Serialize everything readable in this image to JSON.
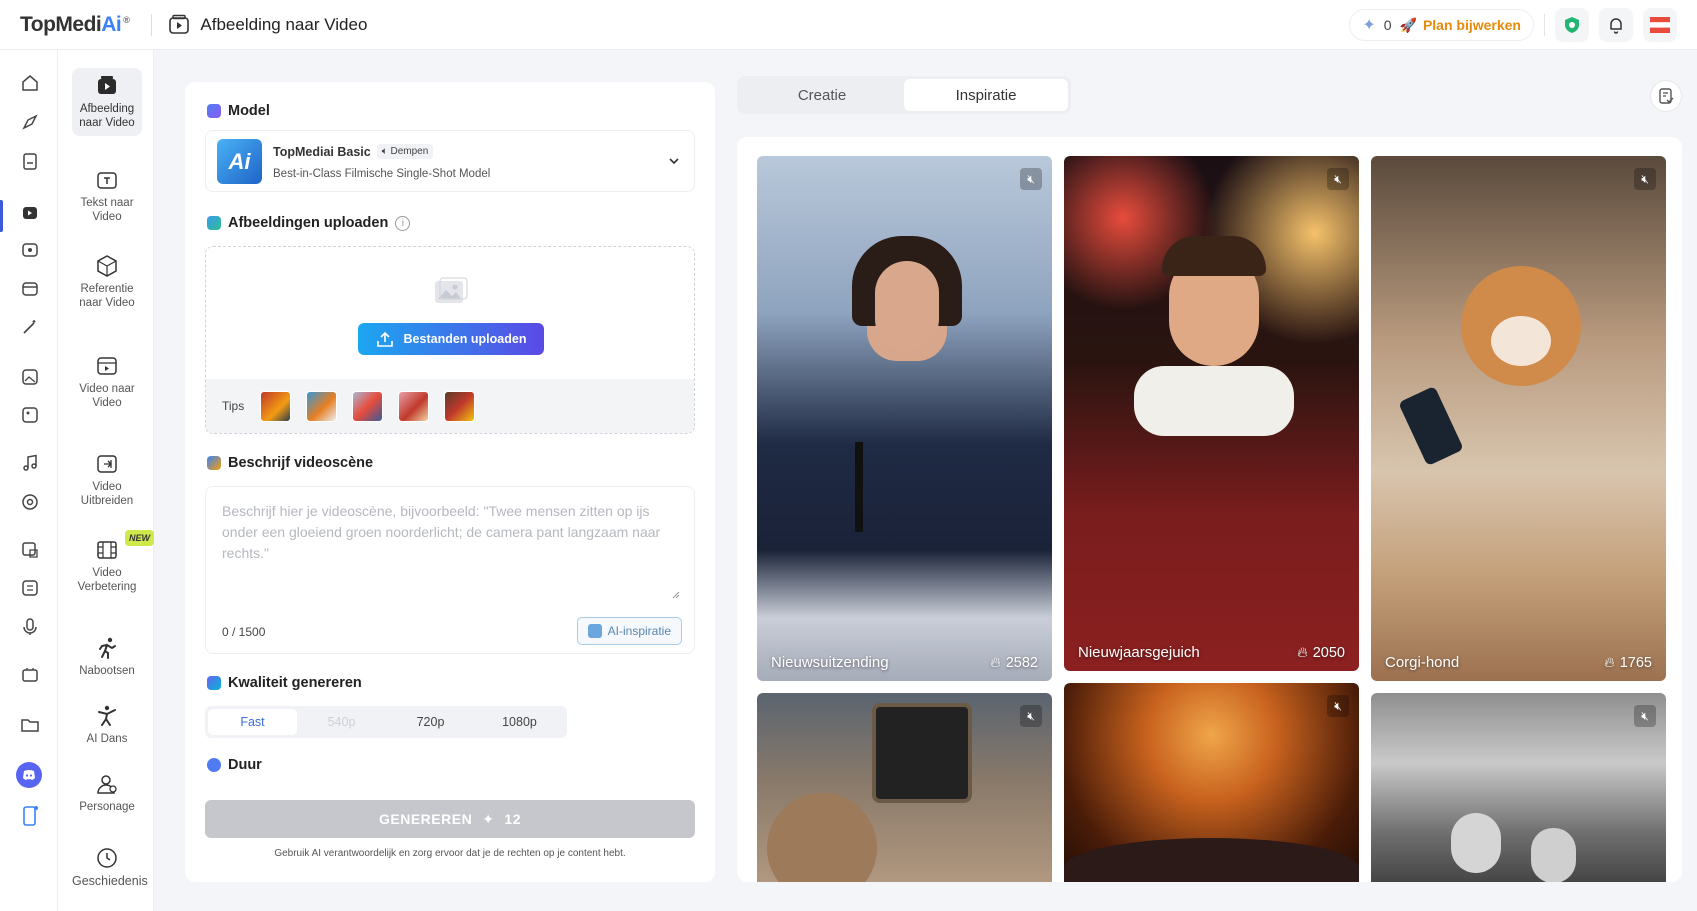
{
  "header": {
    "logo_main": "TopMedi",
    "logo_ai": "Ai",
    "logo_reg": "®",
    "page_title": "Afbeelding naar Video",
    "credits": "0",
    "upgrade_label": "Plan bijwerken"
  },
  "tools": [
    {
      "label": "Afbeelding naar Video",
      "icon": "image-video-icon"
    },
    {
      "label": "Tekst naar Video",
      "icon": "text-video-icon"
    },
    {
      "label": "Referentie naar Video",
      "icon": "reference-video-icon"
    },
    {
      "label": "Video naar Video",
      "icon": "video-video-icon"
    },
    {
      "label": "Video Uitbreiden",
      "icon": "video-extend-icon"
    },
    {
      "label": "Video Verbetering",
      "icon": "video-enhance-icon",
      "badge": "NEW"
    },
    {
      "label": "Nabootsen",
      "icon": "running-person-icon"
    },
    {
      "label": "AI Dans",
      "icon": "dance-icon"
    },
    {
      "label": "Personage",
      "icon": "character-icon"
    },
    {
      "label": "Geschiedenis",
      "icon": "history-icon"
    }
  ],
  "model": {
    "section_title": "Model",
    "name": "TopMediai Basic",
    "mute_tag": "Dempen",
    "description": "Best-in-Class Filmische Single-Shot Model",
    "thumb_text": "Ai"
  },
  "upload": {
    "section_title": "Afbeeldingen uploaden",
    "button_label": "Bestanden uploaden",
    "tips_label": "Tips"
  },
  "describe": {
    "section_title": "Beschrijf videoscène",
    "placeholder": "Beschrijf hier je videoscène, bijvoorbeeld: \"Twee mensen zitten op ijs onder een gloeiend groen noorderlicht; de camera pant langzaam naar rechts.\"",
    "counter": "0 / 1500",
    "ai_button": "AI-inspiratie"
  },
  "quality": {
    "section_title": "Kwaliteit genereren",
    "options": [
      "Fast",
      "540p",
      "720p",
      "1080p"
    ]
  },
  "duration": {
    "section_title": "Duur"
  },
  "generate": {
    "label": "GENEREREN",
    "cost": "12",
    "disclaimer": "Gebruik AI verantwoordelijk en zorg ervoor dat je de rechten op je content hebt."
  },
  "tabs": [
    "Creatie",
    "Inspiratie"
  ],
  "gallery": [
    {
      "caption": "Nieuwsuitzending",
      "likes": "2582"
    },
    {
      "caption": "Nieuwjaarsgejuich",
      "likes": "2050"
    },
    {
      "caption": "Corgi-hond",
      "likes": "1765"
    },
    {
      "caption": "",
      "likes": ""
    },
    {
      "caption": "",
      "likes": ""
    },
    {
      "caption": "",
      "likes": ""
    }
  ]
}
